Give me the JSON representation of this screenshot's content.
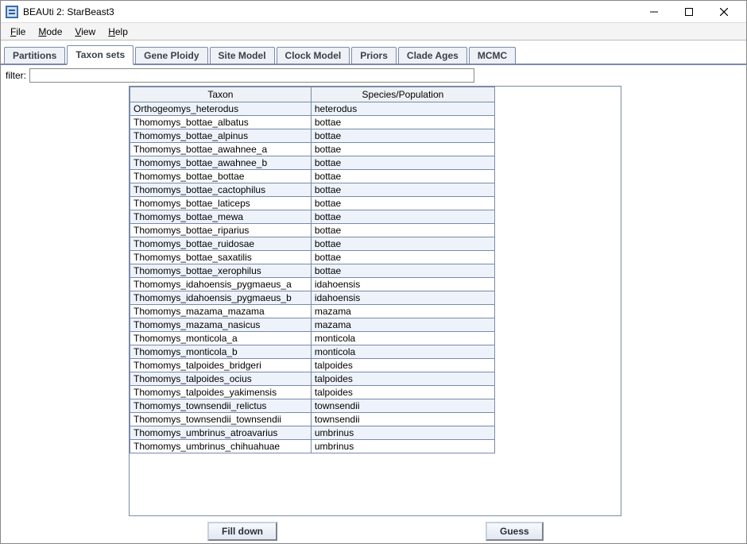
{
  "window": {
    "title": "BEAUti 2: StarBeast3"
  },
  "menubar": {
    "items": [
      {
        "label": "File",
        "accel": "F"
      },
      {
        "label": "Mode",
        "accel": "M"
      },
      {
        "label": "View",
        "accel": "V"
      },
      {
        "label": "Help",
        "accel": "H"
      }
    ]
  },
  "tabs": [
    {
      "label": "Partitions",
      "active": false
    },
    {
      "label": "Taxon sets",
      "active": true
    },
    {
      "label": "Gene Ploidy",
      "active": false
    },
    {
      "label": "Site Model",
      "active": false
    },
    {
      "label": "Clock Model",
      "active": false
    },
    {
      "label": "Priors",
      "active": false
    },
    {
      "label": "Clade Ages",
      "active": false
    },
    {
      "label": "MCMC",
      "active": false
    }
  ],
  "filter": {
    "label": "filter:",
    "value": ""
  },
  "table": {
    "columns": [
      "Taxon",
      "Species/Population"
    ],
    "rows": [
      {
        "taxon": "Orthogeomys_heterodus",
        "species": "heterodus"
      },
      {
        "taxon": "Thomomys_bottae_albatus",
        "species": "bottae"
      },
      {
        "taxon": "Thomomys_bottae_alpinus",
        "species": "bottae"
      },
      {
        "taxon": "Thomomys_bottae_awahnee_a",
        "species": "bottae"
      },
      {
        "taxon": "Thomomys_bottae_awahnee_b",
        "species": "bottae"
      },
      {
        "taxon": "Thomomys_bottae_bottae",
        "species": "bottae"
      },
      {
        "taxon": "Thomomys_bottae_cactophilus",
        "species": "bottae"
      },
      {
        "taxon": "Thomomys_bottae_laticeps",
        "species": "bottae"
      },
      {
        "taxon": "Thomomys_bottae_mewa",
        "species": "bottae"
      },
      {
        "taxon": "Thomomys_bottae_riparius",
        "species": "bottae"
      },
      {
        "taxon": "Thomomys_bottae_ruidosae",
        "species": "bottae"
      },
      {
        "taxon": "Thomomys_bottae_saxatilis",
        "species": "bottae"
      },
      {
        "taxon": "Thomomys_bottae_xerophilus",
        "species": "bottae"
      },
      {
        "taxon": "Thomomys_idahoensis_pygmaeus_a",
        "species": "idahoensis"
      },
      {
        "taxon": "Thomomys_idahoensis_pygmaeus_b",
        "species": "idahoensis"
      },
      {
        "taxon": "Thomomys_mazama_mazama",
        "species": "mazama"
      },
      {
        "taxon": "Thomomys_mazama_nasicus",
        "species": "mazama"
      },
      {
        "taxon": "Thomomys_monticola_a",
        "species": "monticola"
      },
      {
        "taxon": "Thomomys_monticola_b",
        "species": "monticola"
      },
      {
        "taxon": "Thomomys_talpoides_bridgeri",
        "species": "talpoides"
      },
      {
        "taxon": "Thomomys_talpoides_ocius",
        "species": "talpoides"
      },
      {
        "taxon": "Thomomys_talpoides_yakimensis",
        "species": "talpoides"
      },
      {
        "taxon": "Thomomys_townsendii_relictus",
        "species": "townsendii"
      },
      {
        "taxon": "Thomomys_townsendii_townsendii",
        "species": "townsendii"
      },
      {
        "taxon": "Thomomys_umbrinus_atroavarius",
        "species": "umbrinus"
      },
      {
        "taxon": "Thomomys_umbrinus_chihuahuae",
        "species": "umbrinus"
      }
    ]
  },
  "buttons": {
    "fill_down": "Fill down",
    "guess": "Guess"
  }
}
